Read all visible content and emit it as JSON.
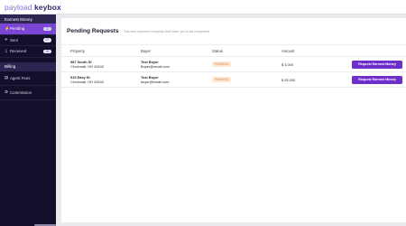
{
  "app": {
    "logo_part1": "payload",
    "logo_part2": "keybox"
  },
  "sidebar": {
    "section_earnest": "Earnest Money",
    "items": [
      {
        "icon": "⚡",
        "label": "Pending",
        "badge": "2"
      },
      {
        "icon": "✈",
        "label": "Sent",
        "badge": "27"
      },
      {
        "icon": "⇩",
        "label": "Received",
        "badge": "48"
      }
    ],
    "section_billing": "Billing",
    "billing_items": [
      {
        "icon": "▤",
        "label": "Agent Fees"
      },
      {
        "icon": "⚙",
        "label": "Commission"
      }
    ]
  },
  "main": {
    "title": "Pending Requests",
    "subtitle": "Earnest payment requests that have yet to be requested",
    "columns": [
      "Property",
      "Buyer",
      "Status",
      "Amount"
    ],
    "rows": [
      {
        "address": "987 South St",
        "city": "Cincinnati, OH 45242",
        "buyer_name": "Test Buyer",
        "buyer_email": "Buyer@email.com",
        "status": "PENDING",
        "amount": "$ 3,000",
        "action": "Request Earnest Money"
      },
      {
        "address": "519 Easy St",
        "city": "Cincinnati, OH 45242",
        "buyer_name": "Test Buyer",
        "buyer_email": "buyer@email.com",
        "status": "PENDING",
        "amount": "$ 93,000",
        "action": "Request Earnest Money"
      }
    ]
  },
  "colors": {
    "sidebar_bg": "#130f2a",
    "active_item": "#7b46d6",
    "primary_button": "#6d2fc8",
    "pending_badge_bg": "#fde8d4",
    "pending_badge_text": "#d9864a"
  }
}
